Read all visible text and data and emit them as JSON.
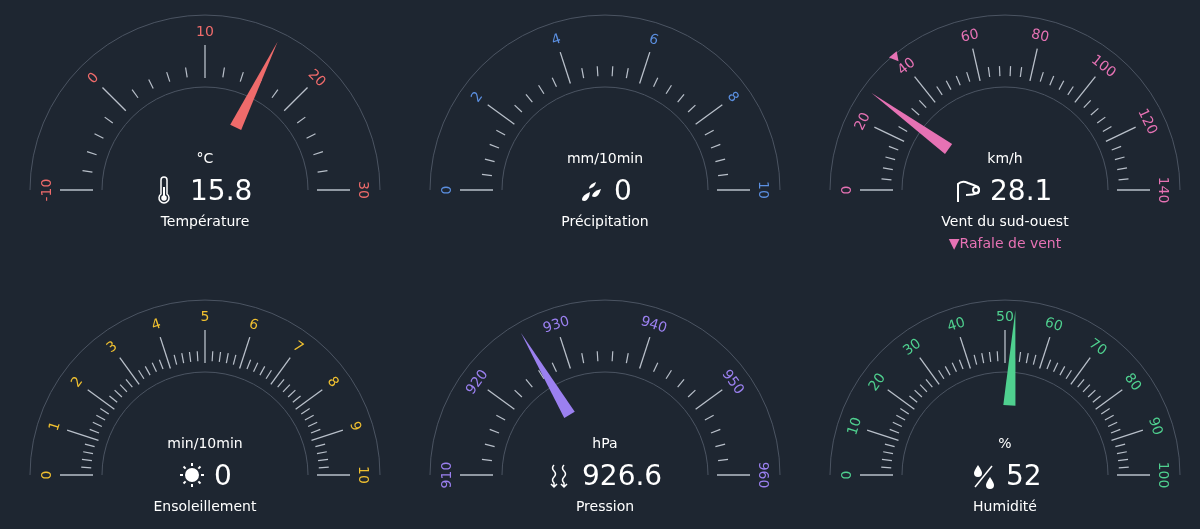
{
  "gauges": [
    {
      "name": "Température",
      "unit": "°C",
      "value": "15.8",
      "level": 0.645,
      "color": "#ef6b6b",
      "ticks": [
        "-10",
        "0",
        "10",
        "20",
        "30"
      ]
    },
    {
      "name": "Précipitation",
      "unit": "mm/10min",
      "value": "0",
      "color": "#5b8fe0",
      "ticks": [
        "0",
        "2",
        "4",
        "6",
        "8",
        "10"
      ]
    },
    {
      "name": "Vent du sud-ouest",
      "unit": "km/h",
      "value": "28.1",
      "level": 0.2,
      "color": "#e672b4",
      "ticks": [
        "0",
        "20",
        "40",
        "60",
        "80",
        "100",
        "120",
        "140"
      ],
      "gust": {
        "level": 0.28,
        "marker": "▼",
        "label": "Rafale de vent"
      }
    },
    {
      "name": "Ensoleillement",
      "unit": "min/10min",
      "value": "0",
      "color": "#f0c030",
      "ticks": [
        "0",
        "1",
        "2",
        "3",
        "4",
        "5",
        "6",
        "7",
        "8",
        "9",
        "10"
      ]
    },
    {
      "name": "Pression",
      "unit": "hPa",
      "value": "926.6",
      "level": 0.33,
      "color": "#9b80f0",
      "ticks": [
        "910",
        "920",
        "930",
        "940",
        "950",
        "960"
      ]
    },
    {
      "name": "Humidité",
      "unit": "%",
      "value": "52",
      "level": 0.52,
      "color": "#4fd08f",
      "ticks": [
        "0",
        "10",
        "20",
        "30",
        "40",
        "50",
        "60",
        "70",
        "80",
        "90",
        "100"
      ]
    }
  ]
}
